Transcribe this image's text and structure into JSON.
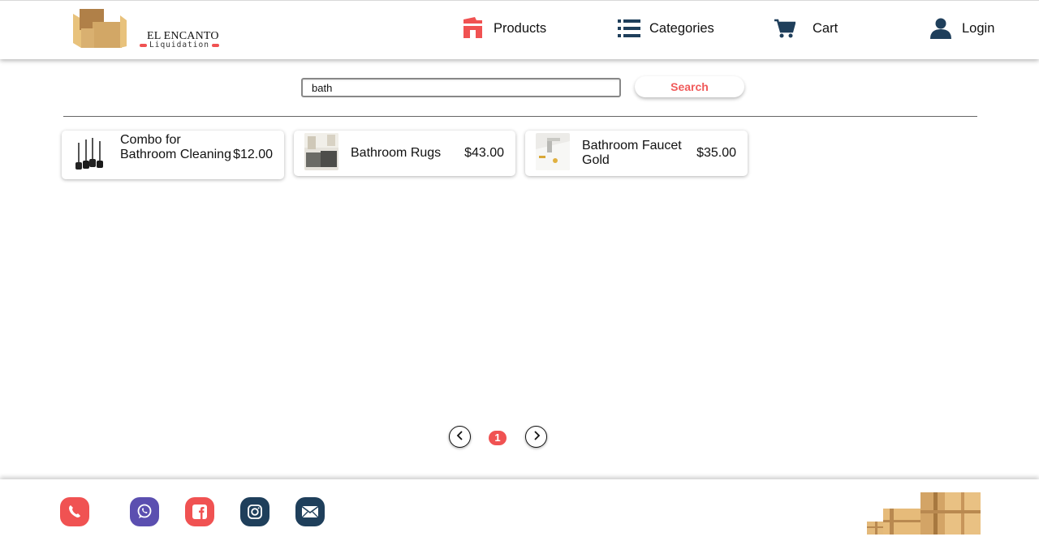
{
  "brand": {
    "name": "EL ENCANTO",
    "tagline": "Liquidation",
    "accent_color": "#f05252",
    "dark_color": "#1f3f5b"
  },
  "nav": {
    "products": {
      "label": "Products",
      "icon": "home-icon"
    },
    "categories": {
      "label": "Categories",
      "icon": "list-icon"
    },
    "cart": {
      "label": "Cart",
      "icon": "cart-icon"
    },
    "login": {
      "label": "Login",
      "icon": "user-icon"
    }
  },
  "search": {
    "value": "bath",
    "button_label": "Search"
  },
  "products": [
    {
      "name": "Combo for Bathroom Cleaning",
      "price": "$12.00"
    },
    {
      "name": "Bathroom Rugs",
      "price": "$43.00"
    },
    {
      "name": "Bathroom Faucet Gold",
      "price": "$35.00"
    }
  ],
  "pagination": {
    "current_page": "1",
    "prev_icon": "chevron-left-icon",
    "next_icon": "chevron-right-icon"
  },
  "footer": {
    "social": [
      {
        "name": "phone",
        "color": "#f05252"
      },
      {
        "name": "whatsapp",
        "color": "#5b4fb0"
      },
      {
        "name": "facebook",
        "color": "#f05252"
      },
      {
        "name": "instagram",
        "color": "#1f3f5b"
      },
      {
        "name": "email",
        "color": "#1f3f5b"
      }
    ]
  }
}
